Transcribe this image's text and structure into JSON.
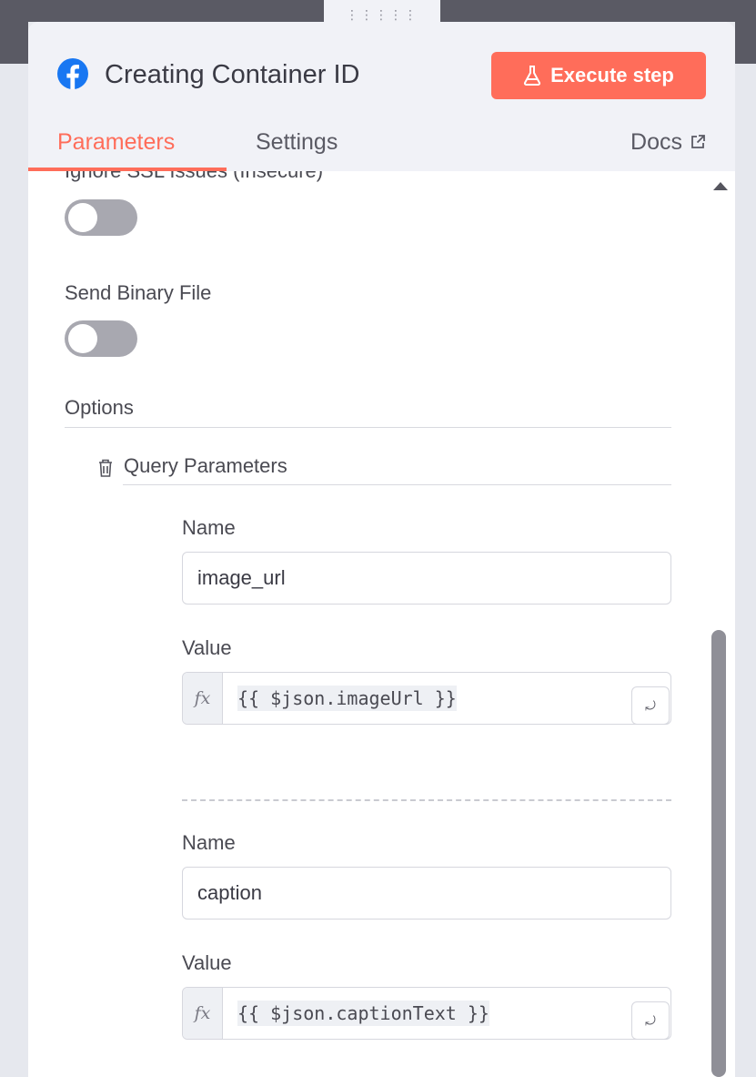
{
  "header": {
    "title": "Creating Container ID",
    "execute_label": "Execute step",
    "tabs": {
      "parameters": "Parameters",
      "settings": "Settings"
    },
    "docs_label": "Docs"
  },
  "fields": {
    "ignore_ssl_label": "Ignore SSL Issues (Insecure)",
    "ignore_ssl_on": false,
    "send_binary_label": "Send Binary File",
    "send_binary_on": false,
    "options_label": "Options",
    "query_parameters_label": "Query Parameters",
    "params": [
      {
        "name_label": "Name",
        "name_value": "image_url",
        "value_label": "Value",
        "value_fx": "fx",
        "value_expr": "{{ $json.imageUrl }}"
      },
      {
        "name_label": "Name",
        "name_value": "caption",
        "value_label": "Value",
        "value_fx": "fx",
        "value_expr": "{{ $json.captionText }}"
      }
    ]
  },
  "icons": [
    "facebook-icon",
    "flask-icon",
    "external-link-icon",
    "trash-icon",
    "mapping-icon",
    "drag-handle-icon"
  ],
  "colors": {
    "accent": "#ff6d5a",
    "facebook": "#1877f2",
    "toggle_off": "#a8a8b0"
  }
}
